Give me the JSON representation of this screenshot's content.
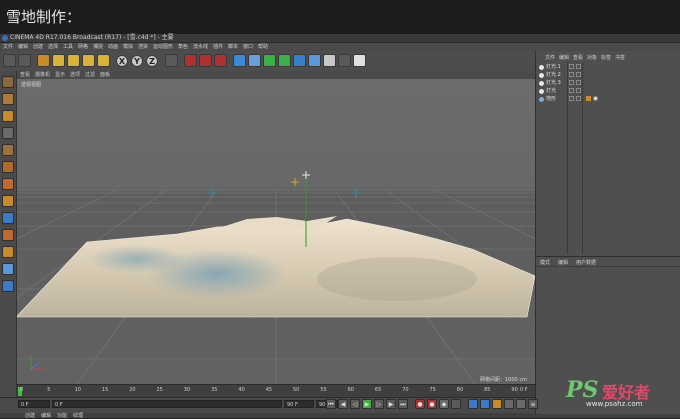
{
  "caption": "雪地制作：",
  "window_title": "CINEMA 4D R17.016 Broadcast (R17) - [雪.c4d *] - 主要",
  "menu": [
    "文件",
    "编辑",
    "创建",
    "选择",
    "工具",
    "网格",
    "捕捉",
    "动画",
    "模拟",
    "渲染",
    "运动图形",
    "角色",
    "流水线",
    "插件",
    "脚本",
    "窗口",
    "帮助"
  ],
  "toolbar_icons": [
    "undo-icon",
    "redo-icon",
    "select-icon",
    "move-icon",
    "scale-icon",
    "rotate-icon",
    "add-icon",
    "x-axis-icon",
    "y-axis-icon",
    "z-axis-icon",
    "coordinate-icon",
    "render-view-icon",
    "render-picture-icon",
    "render-settings-icon",
    "cube-icon",
    "pen-icon",
    "subdivision-icon",
    "array-icon",
    "deformer-icon",
    "environment-icon",
    "floor-icon",
    "camera-icon",
    "light-icon"
  ],
  "axis_labels": {
    "x": "X",
    "y": "Y",
    "z": "Z"
  },
  "viewport_menu": [
    "查看",
    "摄像机",
    "显示",
    "选项",
    "过滤",
    "面板"
  ],
  "viewport_label": "透视视图",
  "grid_readout": "网格间距：1000 cm",
  "timeline_ticks": [
    "0",
    "5",
    "10",
    "15",
    "20",
    "25",
    "30",
    "35",
    "40",
    "45",
    "50",
    "55",
    "60",
    "65",
    "70",
    "75",
    "80",
    "85",
    "90"
  ],
  "timeline_end": "0 F",
  "playbar": {
    "current_frame": "0 F",
    "start_frame": "0 F",
    "end_frame": "90 F",
    "end_frame2": "90 F"
  },
  "object_tabs": [
    "文件",
    "编辑",
    "查看",
    "对象",
    "标签",
    "书签"
  ],
  "objects": [
    "灯光.1",
    "灯光.2",
    "灯光.3",
    "灯光",
    "地形"
  ],
  "attr_tabs": [
    "模式",
    "编辑",
    "用户数据"
  ],
  "bottom_tabs": [
    "创建",
    "编辑",
    "功能",
    "纹理"
  ],
  "watermark": {
    "ps": "PS",
    "cn": "爱好者",
    "url": "www.psahz.com"
  },
  "colors": {
    "bg": "#1e1e1e",
    "ui": "#4a4a4a",
    "viewport": "#666666",
    "snow": "#e8dcc8",
    "accent_blue": "#3b6fb5"
  }
}
